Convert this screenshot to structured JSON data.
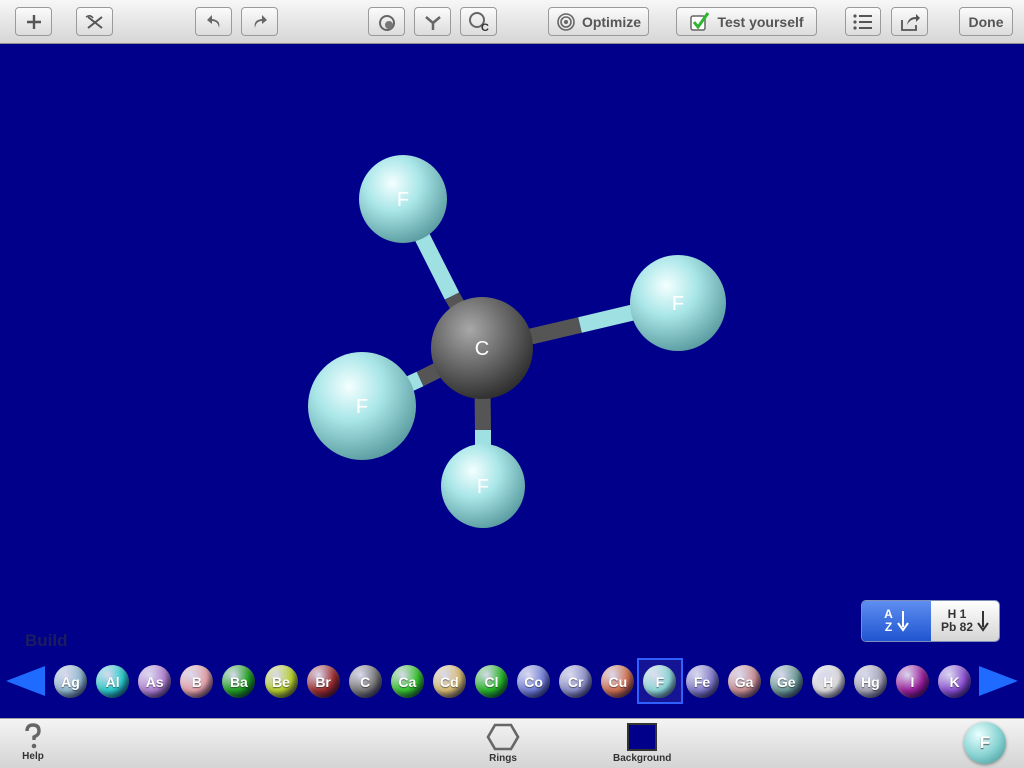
{
  "toolbar": {
    "optimize_label": "Optimize",
    "test_label": "Test yourself",
    "done_label": "Done"
  },
  "molecule": {
    "center": {
      "symbol": "C"
    },
    "ligands": [
      {
        "symbol": "F"
      },
      {
        "symbol": "F"
      },
      {
        "symbol": "F"
      },
      {
        "symbol": "F"
      }
    ]
  },
  "sort": {
    "az_top": "A",
    "az_bottom": "Z",
    "hpb_top": "H 1",
    "hpb_bottom": "Pb 82"
  },
  "build_label": "Build",
  "elements": [
    {
      "symbol": "Ag",
      "color": "#8fb7cc"
    },
    {
      "symbol": "Al",
      "color": "#28c9c9"
    },
    {
      "symbol": "As",
      "color": "#b07fd0"
    },
    {
      "symbol": "B",
      "color": "#e3a0a6"
    },
    {
      "symbol": "Ba",
      "color": "#1fa01f"
    },
    {
      "symbol": "Be",
      "color": "#b7cf2a"
    },
    {
      "symbol": "Br",
      "color": "#9b2c2c"
    },
    {
      "symbol": "C",
      "color": "#777777"
    },
    {
      "symbol": "Ca",
      "color": "#35c22a"
    },
    {
      "symbol": "Cd",
      "color": "#d6ba70"
    },
    {
      "symbol": "Cl",
      "color": "#25b525"
    },
    {
      "symbol": "Co",
      "color": "#6f7dd6"
    },
    {
      "symbol": "Cr",
      "color": "#8a8ec7"
    },
    {
      "symbol": "Cu",
      "color": "#d07050"
    },
    {
      "symbol": "F",
      "color": "#8cd6d6"
    },
    {
      "symbol": "Fe",
      "color": "#7f78c7"
    },
    {
      "symbol": "Ga",
      "color": "#c98f92"
    },
    {
      "symbol": "Ge",
      "color": "#6b9a95"
    },
    {
      "symbol": "H",
      "color": "#dcdcdc"
    },
    {
      "symbol": "Hg",
      "color": "#a7a7b8"
    },
    {
      "symbol": "I",
      "color": "#9a1f9a"
    },
    {
      "symbol": "K",
      "color": "#8a4fd0"
    }
  ],
  "selected_element": "F",
  "bottom": {
    "help": "Help",
    "rings": "Rings",
    "background": "Background",
    "current_element": "F"
  },
  "colors": {
    "background": "#00008b",
    "carbon": "#666666",
    "fluorine": "#a6e3e6"
  }
}
